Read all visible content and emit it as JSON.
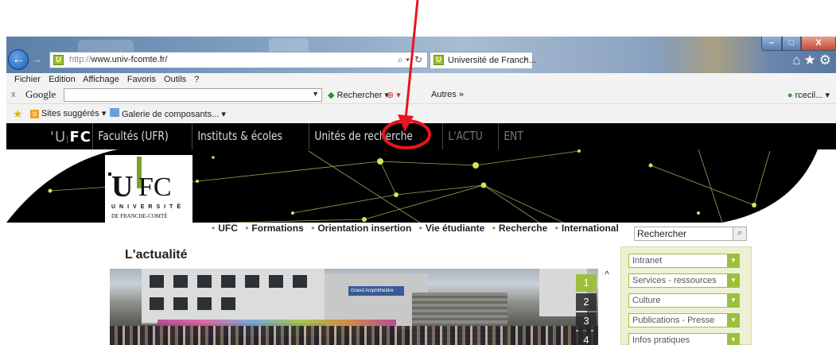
{
  "browser": {
    "url_prefix": "http://",
    "url_host": "www.univ-fcomte.fr/",
    "tab_title": "Université de Franch...",
    "tab_close": "×",
    "menu": [
      "Fichier",
      "Edition",
      "Affichage",
      "Favoris",
      "Outils",
      "?"
    ],
    "toolbar_close": "x",
    "google_logo": "Google",
    "google_search": "Rechercher",
    "google_other": "Autres »",
    "user": "rcecil...",
    "favorites": [
      "Sites suggérés ▾",
      "Galerie de composants... ▾"
    ],
    "favicon_letter": "U",
    "window_close": "X"
  },
  "site": {
    "logo": {
      "left": "'U",
      "bar": "|",
      "right": "FC"
    },
    "topnav": [
      "Facultés (UFR)",
      "Instituts & écoles",
      "Unités de recherche",
      "L'ACTU",
      "ENT"
    ],
    "logo_box": {
      "u": "U",
      "fc": "FC",
      "line1": "UNIVERSITÉ",
      "line2": "DE FRANCHE-COMTÉ"
    },
    "mainnav": [
      "UFC",
      "Formations",
      "Orientation insertion",
      "Vie étudiante",
      "Recherche",
      "International"
    ],
    "search_placeholder": "Rechercher",
    "section_title": "L'actualité",
    "photo_sign": "Grand Amphithéâtre",
    "pager": [
      "1",
      "2",
      "3",
      "4"
    ],
    "sidebar": [
      "Intranet",
      "Services - ressources",
      "Culture",
      "Publications - Presse",
      "Infos pratiques"
    ]
  },
  "colors": {
    "accent_green": "#9cbf3c",
    "annotation_red": "#e8141e"
  }
}
